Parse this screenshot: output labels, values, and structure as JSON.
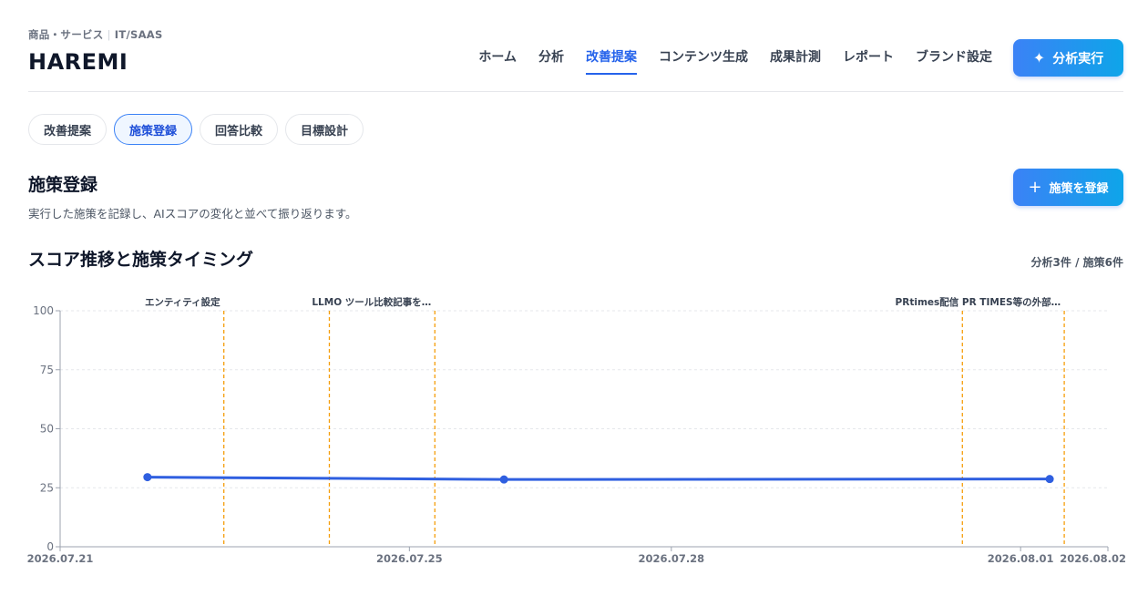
{
  "header": {
    "category": "商品・サービス",
    "industry": "IT/SAAS",
    "brand": "HAREMI",
    "nav": [
      "ホーム",
      "分析",
      "改善提案",
      "コンテンツ生成",
      "成果計測",
      "レポート",
      "ブランド設定"
    ],
    "active_nav": "改善提案",
    "analyze_button": "分析実行",
    "analyze_icon": "sparkles-icon"
  },
  "subtabs": {
    "items": [
      "改善提案",
      "施策登録",
      "回答比較",
      "目標設計"
    ],
    "active": "施策登録"
  },
  "page": {
    "title": "施策登録",
    "description": "実行した施策を記録し、AIスコアの変化と並べて振り返ります。",
    "register_button": "施策を登録",
    "register_icon": "plus-icon"
  },
  "section": {
    "title": "スコア推移と施策タイミング",
    "counts": "分析3件 / 施策6件"
  },
  "colors": {
    "accent": "#2563eb",
    "line": "#2f5fe0",
    "marker": "#f59e0b"
  },
  "chart_data": {
    "type": "line",
    "x_ticks": [
      "2026.07.21",
      "2026.07.25",
      "2026.07.28",
      "2026.08.01",
      "2026.08.02"
    ],
    "x_range": [
      "2026-07-21",
      "2026-08-02"
    ],
    "y_ticks": [
      0,
      25,
      50,
      75,
      100
    ],
    "ylim": [
      0,
      100
    ],
    "grid": true,
    "series": [
      {
        "points": [
          {
            "x": "2026-07-22 00:00",
            "y": 29.5
          },
          {
            "x": "2026-07-26 02:00",
            "y": 28.5
          },
          {
            "x": "2026-08-01 08:00",
            "y": 28.7
          }
        ]
      }
    ],
    "markers": [
      {
        "x": "2026-07-22 21:00",
        "label": "エンティティ設定"
      },
      {
        "x": "2026-07-24 02:00",
        "label": ""
      },
      {
        "x": "2026-07-25 07:00",
        "label": "LLMO ツール比較記事を…"
      },
      {
        "x": "2026-07-31 08:00",
        "label": "PRtimes配信"
      },
      {
        "x": "2026-08-01 12:00",
        "label": "PR TIMES等の外部…"
      }
    ]
  }
}
